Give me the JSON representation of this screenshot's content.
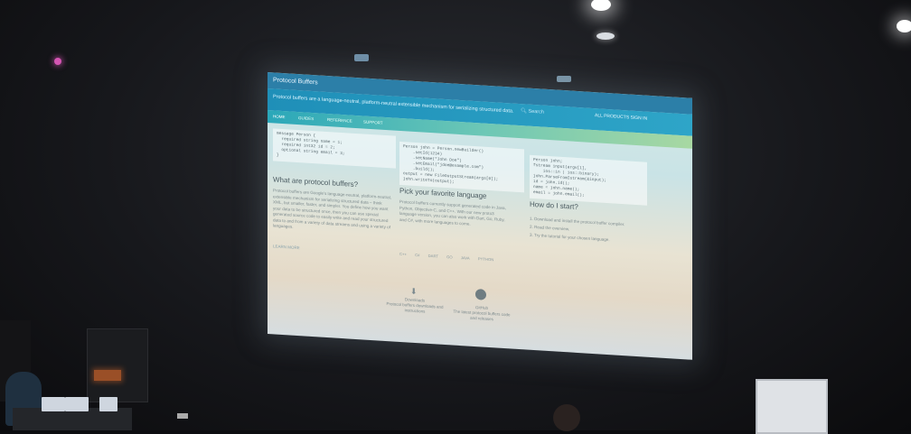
{
  "screen": {
    "window_title": "Protocol Buffers",
    "tagline": "Protocol buffers are a language-neutral, platform-neutral extensible mechanism for serializing structured data.",
    "search": "Search",
    "nav": "ALL PRODUCTS   SIGN IN",
    "tabs": [
      "HOME",
      "GUIDES",
      "REFERENCE",
      "SUPPORT"
    ],
    "code_1": "message Person {\n  required string name = 1;\n  required int32 id = 2;\n  optional string email = 3;\n}",
    "code_2": "Person john = Person.newBuilder()\n    .setId(1234)\n    .setName(\"John Doe\")\n    .setEmail(\"jdoe@example.com\")\n    .build();\noutput = new FileOutputStream(args[0]);\njohn.writeTo(output);",
    "code_3": "Person john;\nfstream input(argv[1],\n    ios::in | ios::binary);\njohn.ParseFromIstream(&input);\nid = john.id();\nname = john.name();\nemail = john.email();",
    "section_1_title": "What are protocol buffers?",
    "section_1_text": "Protocol buffers are Google's language-neutral, platform-neutral, extensible mechanism for serializing structured data – think XML, but smaller, faster, and simpler. You define how you want your data to be structured once, then you can use special generated source code to easily write and read your structured data to and from a variety of data streams and using a variety of languages.",
    "learn_more": "LEARN MORE",
    "section_2_title": "Pick your favorite language",
    "section_2_text": "Protocol buffers currently support generated code in Java, Python, Objective-C, and C++. With our new proto3 language version, you can also work with Dart, Go, Ruby, and C#, with more languages to come.",
    "languages": [
      "C++",
      "C#",
      "DART",
      "GO",
      "JAVA",
      "PYTHON"
    ],
    "section_3_title": "How do I start?",
    "steps": [
      "1. Download and install the protocol buffer compiler.",
      "2. Read the overview.",
      "3. Try the tutorial for your chosen language."
    ],
    "downloads_label": "Downloads",
    "downloads_text": "Protocol buffers downloads and instructions",
    "github_label": "GitHub",
    "github_text": "The latest protocol buffers code and releases"
  }
}
